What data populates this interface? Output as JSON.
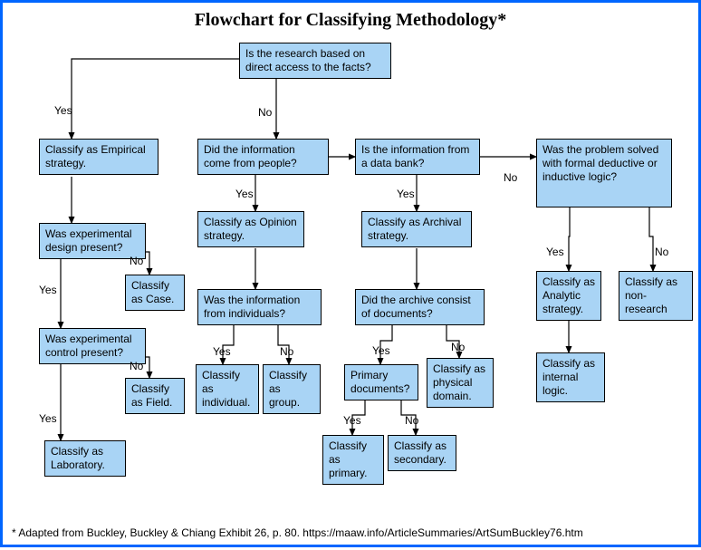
{
  "chart_data": {
    "type": "flowchart",
    "title": "Flowchart for Classifying Methodology*",
    "footnote": "* Adapted from Buckley, Buckley & Chiang Exhibit 26, p. 80. https://maaw.info/ArticleSummaries/ArtSumBuckley76.htm",
    "nodes": {
      "root": "Is the research based on direct access to the facts?",
      "empirical": "Classify as Empirical strategy.",
      "exp_design": "Was experimental design present?",
      "case": "Classify as Case.",
      "exp_control": "Was experimental control present?",
      "field": "Classify as Field.",
      "laboratory": "Classify as Laboratory.",
      "from_people": "Did the information come from people?",
      "opinion": "Classify as Opinion strategy.",
      "from_indiv": "Was the information from individuals?",
      "individual": "Classify as individual.",
      "group": "Classify as group.",
      "data_bank": "Is the information from a data bank?",
      "archival": "Classify as Archival strategy.",
      "arch_docs": "Did the archive consist of documents?",
      "physical": "Classify as physical domain.",
      "prim_docs": "Primary documents?",
      "primary": "Classify as primary.",
      "secondary": "Classify as secondary.",
      "logic_q": "Was the problem solved with formal deductive or inductive logic?",
      "analytic": "Classify as Analytic strategy.",
      "internal": "Classify as internal logic.",
      "nonres": "Classify as non-research"
    },
    "edges": {
      "yes": "Yes",
      "no": "No"
    }
  }
}
